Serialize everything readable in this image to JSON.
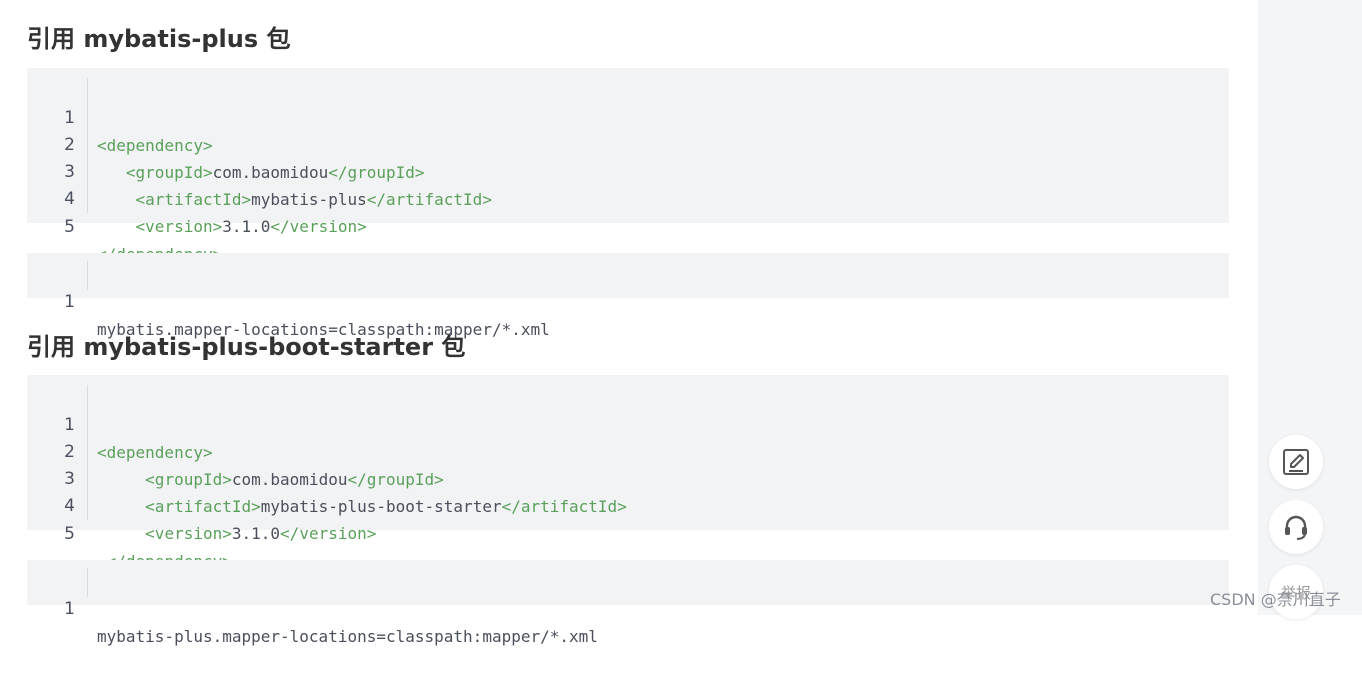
{
  "sections": [
    {
      "heading": "引用 mybatis-plus 包",
      "xml": [
        {
          "num": "1",
          "indent": "",
          "open": "<dependency>",
          "text": "",
          "close": ""
        },
        {
          "num": "2",
          "indent": "   ",
          "open": "<groupId>",
          "text": "com.baomidou",
          "close": "</groupId>"
        },
        {
          "num": "3",
          "indent": "    ",
          "open": "<artifactId>",
          "text": "mybatis-plus",
          "close": "</artifactId>"
        },
        {
          "num": "4",
          "indent": "    ",
          "open": "<version>",
          "text": "3.1.0",
          "close": "</version>"
        },
        {
          "num": "5",
          "indent": "",
          "open": "",
          "text": "",
          "close": "</dependency>"
        }
      ],
      "props": [
        {
          "num": "1",
          "text": "mybatis.mapper-locations=classpath:mapper/*.xml"
        }
      ]
    },
    {
      "heading": "引用 mybatis-plus-boot-starter 包",
      "xml": [
        {
          "num": "1",
          "indent": "",
          "open": "<dependency>",
          "text": "",
          "close": ""
        },
        {
          "num": "2",
          "indent": "     ",
          "open": "<groupId>",
          "text": "com.baomidou",
          "close": "</groupId>"
        },
        {
          "num": "3",
          "indent": "     ",
          "open": "<artifactId>",
          "text": "mybatis-plus-boot-starter",
          "close": "</artifactId>"
        },
        {
          "num": "4",
          "indent": "     ",
          "open": "<version>",
          "text": "3.1.0",
          "close": "</version>"
        },
        {
          "num": "5",
          "indent": " ",
          "open": "",
          "text": "",
          "close": "</dependency>"
        }
      ],
      "props": [
        {
          "num": "1",
          "text": "mybatis-plus.mapper-locations=classpath:mapper/*.xml"
        }
      ]
    }
  ],
  "sidebar": {
    "fab_report_label": "举报"
  },
  "watermark": "CSDN @奈川直子",
  "colors": {
    "tag": "#5aa05a",
    "code_bg": "#f2f3f5",
    "sidebar_bg": "#f4f5f7"
  }
}
